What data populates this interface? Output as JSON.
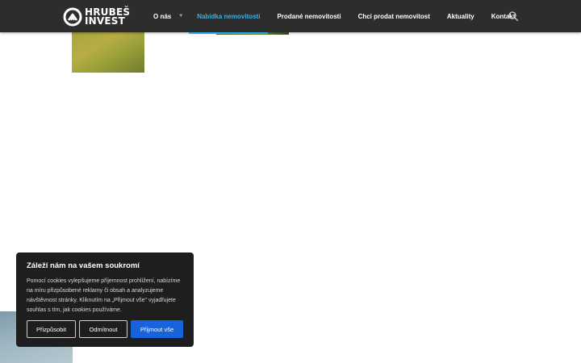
{
  "logo": {
    "line1": "HRUBEŠ",
    "line2": "INVEST",
    "icon": "logo-mark-icon"
  },
  "nav": {
    "items": [
      {
        "label": "O nás",
        "has_dropdown": true
      },
      {
        "label": "Nabídka nemovitostí",
        "active": true
      },
      {
        "label": "Prodané nemovitosti"
      },
      {
        "label": "Chci prodat nemovitost"
      },
      {
        "label": "Aktuality"
      },
      {
        "label": "Kontakt"
      }
    ],
    "dropdown_icon": "chevron-down-icon",
    "search_icon": "search-icon"
  },
  "cookie_banner": {
    "title": "Záleží nám na vašem soukromí",
    "text": "Pomocí cookies vylepšujeme příjemnost prohlížení, nabízíme na míru přizpůsobené reklamy či obsah a analyzujeme návštěvnost stránky. Kliknutím na „Přijmout vše\" vyjadřujete souhlas s tím, jak cookies používáme.",
    "buttons": {
      "customize": "Přizpůsobit",
      "reject": "Odmítnout",
      "accept": "Přijmout vše"
    }
  },
  "colors": {
    "header_bg": "#2d2d2d",
    "nav_active": "#3ab0e6",
    "banner_bg": "#1e1e1e",
    "accept_button": "#1863dc"
  }
}
